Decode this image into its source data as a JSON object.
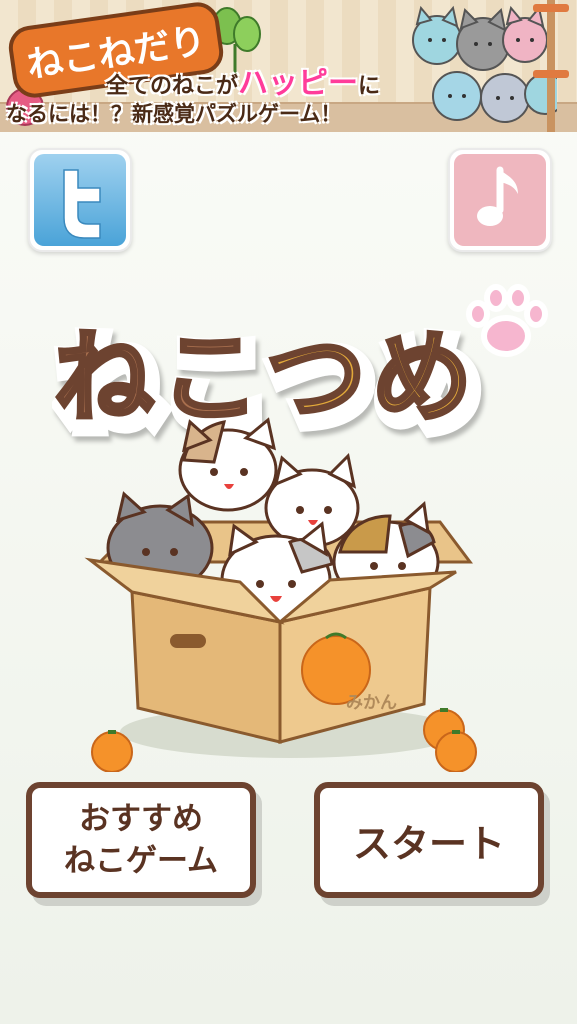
{
  "banner": {
    "logo": "ねこねだり",
    "line1_pre": "全てのねこが",
    "line1_highlight": "ハッピー",
    "line1_post": "に",
    "line2": "なるには！？新感覚パズルゲーム！"
  },
  "title": {
    "logo_text": "ねこつめ"
  },
  "scene": {
    "box_label": "みかん"
  },
  "buttons": {
    "recommend_line1": "おすすめ",
    "recommend_line2": "ねこゲーム",
    "start": "スタート"
  },
  "colors": {
    "brown_outline": "#6d4330",
    "title_brown": "#a86f4e",
    "title_gold": "#e2a93a",
    "twitter_blue": "#4aa3d8",
    "music_pink": "#efb7bf",
    "orange": "#f5922a",
    "box": "#e9c489"
  },
  "icons": [
    "twitter-icon",
    "music-note-icon",
    "paw-icon",
    "yarn-ball-icon"
  ]
}
